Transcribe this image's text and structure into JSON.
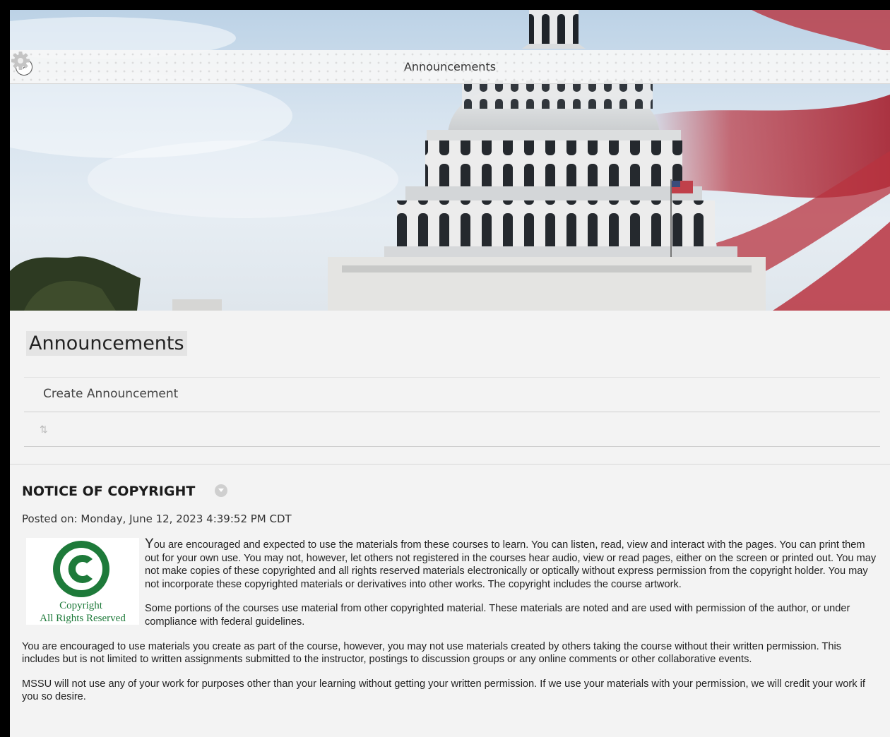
{
  "topbar": {
    "title": "Announcements"
  },
  "page": {
    "title": "Announcements",
    "create_label": "Create Announcement"
  },
  "announcement": {
    "title": "NOTICE OF COPYRIGHT",
    "posted": "Posted on: Monday, June 12, 2023 4:39:52 PM CDT",
    "logo": {
      "line1": "Copyright",
      "line2": "All Rights Reserved"
    },
    "p1_first": "Y",
    "p1_rest": "ou are encouraged and expected to use the materials from these courses to learn. You can listen, read, view and interact with the pages. You can print them out for your own use. You may not, however, let others not registered in the courses hear audio, view or read pages, either on the screen or printed out. You may not make copies of these copyrighted and all rights reserved materials electronically or optically without express permission from the copyright holder. You may not incorporate these copyrighted materials or derivatives into other works. The copyright includes the course artwork.",
    "p2": "Some portions of the courses use material from other copyrighted material. These materials are noted and are used with permission of the author, or under compliance with federal guidelines.",
    "p3": "You are encouraged to use materials you create as part of the course, however, you may not use materials created by others taking the course without their written permission. This includes but is not limited to written assignments submitted to the instructor, postings to discussion groups or any online comments or other collaborative events.",
    "p4": "MSSU will not use any of your work for purposes other than your learning without getting your written permission. If we use your materials with your permission, we will credit your work if you so desire."
  },
  "icons": {
    "menu_toggle": "chevron-right-icon",
    "settings": "gear-icon",
    "sort": "sort-arrows-icon",
    "context": "chevron-down-icon"
  },
  "colors": {
    "copyright_green": "#1e7a3a",
    "flag_red": "#b8333f"
  }
}
